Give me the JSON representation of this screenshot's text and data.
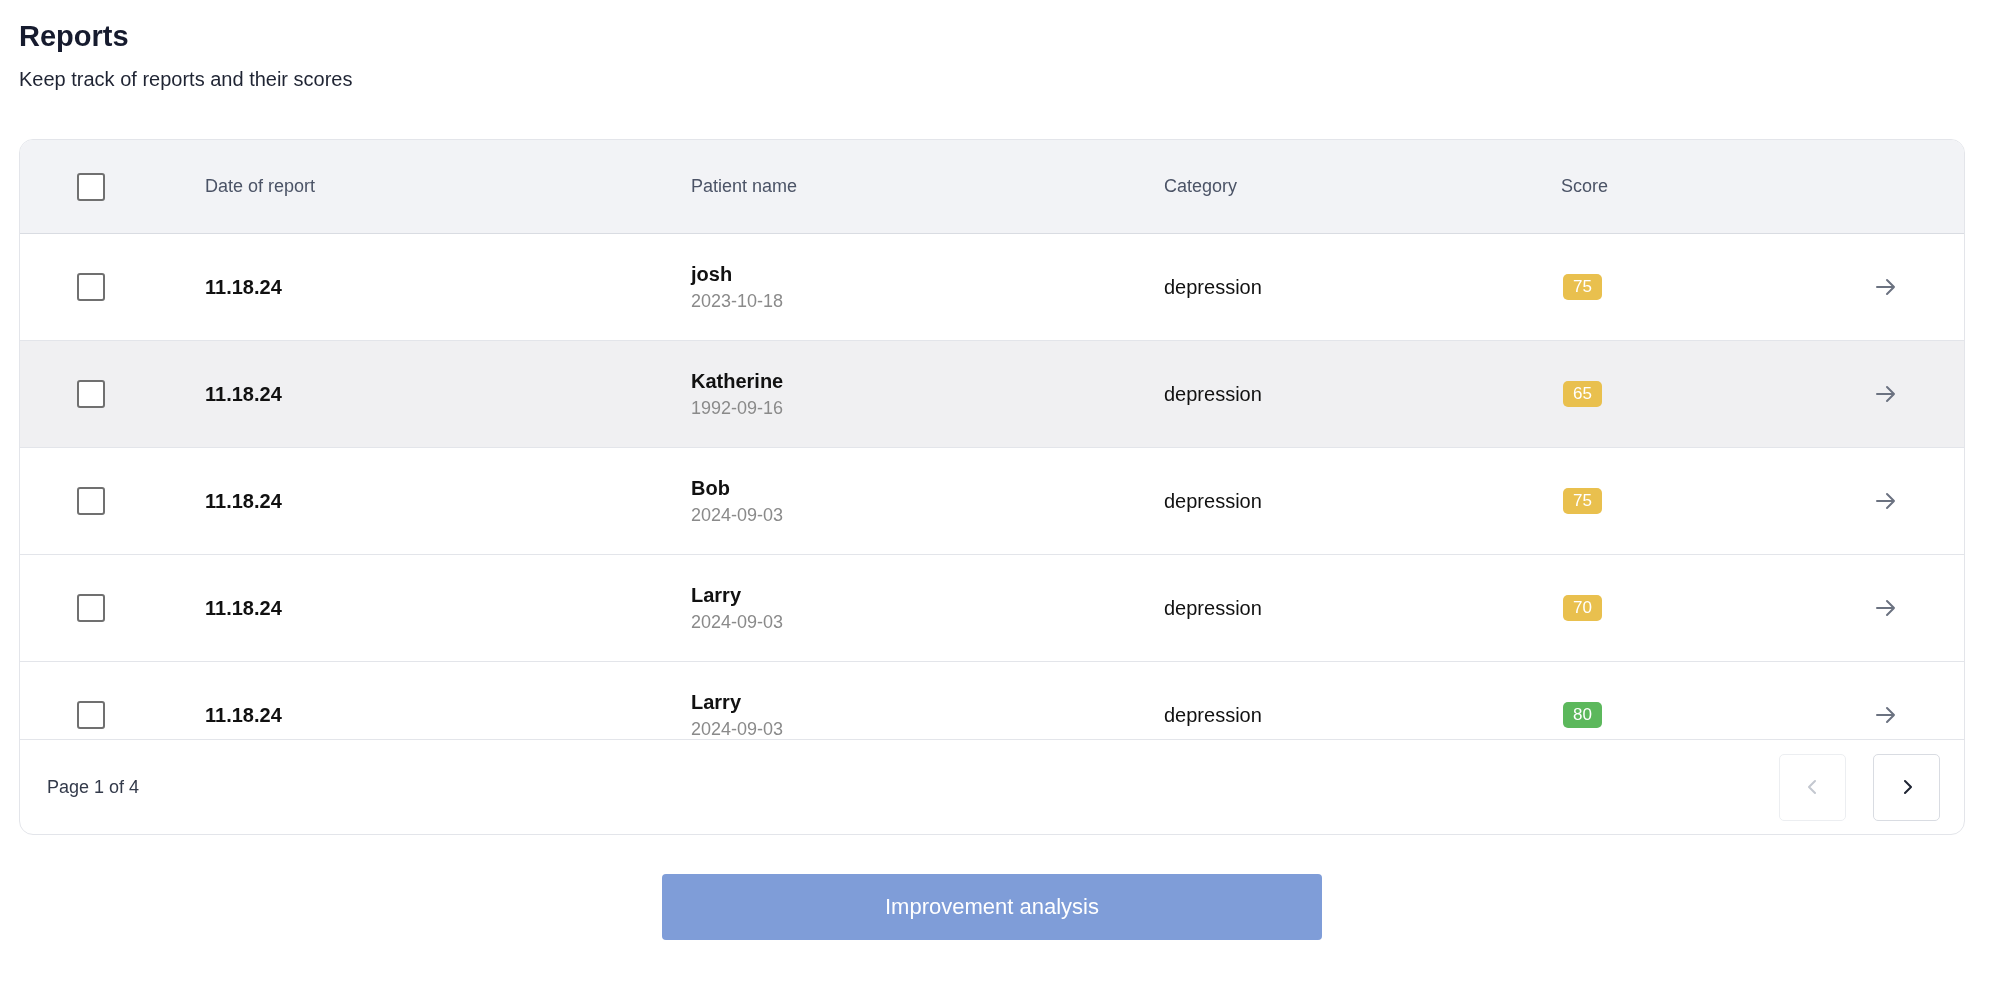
{
  "title": "Reports",
  "subtitle": "Keep track of reports and their scores",
  "table": {
    "select_all": {
      "checked": false
    },
    "columns": [
      "Date of report",
      "Patient name",
      "Category",
      "Score"
    ],
    "rows": [
      {
        "checked": false,
        "highlighted": false,
        "date": "11.18.24",
        "patient": "josh",
        "birthdate": "2023-10-18",
        "category": "depression",
        "score": "75",
        "color": "#e9c04e"
      },
      {
        "checked": false,
        "highlighted": true,
        "date": "11.18.24",
        "patient": "Katherine",
        "birthdate": "1992-09-16",
        "category": "depression",
        "score": "65",
        "color": "#e9c04e"
      },
      {
        "checked": false,
        "highlighted": false,
        "date": "11.18.24",
        "patient": "Bob",
        "birthdate": "2024-09-03",
        "category": "depression",
        "score": "75",
        "color": "#e9c04e"
      },
      {
        "checked": false,
        "highlighted": false,
        "date": "11.18.24",
        "patient": "Larry",
        "birthdate": "2024-09-03",
        "category": "depression",
        "score": "70",
        "color": "#e9c04e"
      },
      {
        "checked": false,
        "highlighted": false,
        "date": "11.18.24",
        "patient": "Larry",
        "birthdate": "2024-09-03",
        "category": "depression",
        "score": "80",
        "color": "#5cb85c"
      }
    ]
  },
  "pagination": {
    "label": "Page 1 of 4",
    "previous": {
      "disabled": true
    },
    "next": {
      "disabled": false
    }
  },
  "action_button": {
    "label": "Improvement analysis",
    "disabled": true
  }
}
